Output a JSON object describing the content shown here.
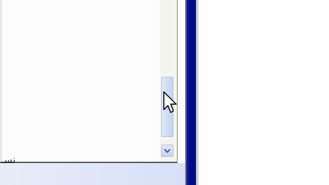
{
  "window": {
    "list_glyph": "نسـ"
  },
  "icons": {
    "scroll_down": "chevron-down-icon",
    "cursor": "mouse-pointer-icon"
  },
  "colors": {
    "splitter": "#0a1890",
    "scrollbar_thumb": "#c4d3f1",
    "panel_background": "#fcfcfc",
    "bottom_bar": "#d7e0f6"
  }
}
